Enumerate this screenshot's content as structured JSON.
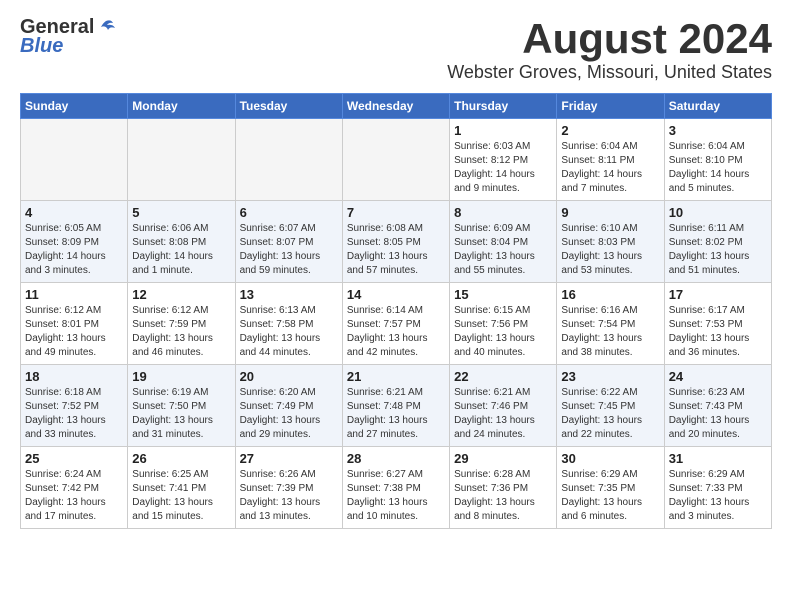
{
  "header": {
    "logo_general": "General",
    "logo_blue": "Blue",
    "month": "August 2024",
    "location": "Webster Groves, Missouri, United States"
  },
  "weekdays": [
    "Sunday",
    "Monday",
    "Tuesday",
    "Wednesday",
    "Thursday",
    "Friday",
    "Saturday"
  ],
  "weeks": [
    [
      {
        "day": "",
        "info": ""
      },
      {
        "day": "",
        "info": ""
      },
      {
        "day": "",
        "info": ""
      },
      {
        "day": "",
        "info": ""
      },
      {
        "day": "1",
        "info": "Sunrise: 6:03 AM\nSunset: 8:12 PM\nDaylight: 14 hours\nand 9 minutes."
      },
      {
        "day": "2",
        "info": "Sunrise: 6:04 AM\nSunset: 8:11 PM\nDaylight: 14 hours\nand 7 minutes."
      },
      {
        "day": "3",
        "info": "Sunrise: 6:04 AM\nSunset: 8:10 PM\nDaylight: 14 hours\nand 5 minutes."
      }
    ],
    [
      {
        "day": "4",
        "info": "Sunrise: 6:05 AM\nSunset: 8:09 PM\nDaylight: 14 hours\nand 3 minutes."
      },
      {
        "day": "5",
        "info": "Sunrise: 6:06 AM\nSunset: 8:08 PM\nDaylight: 14 hours\nand 1 minute."
      },
      {
        "day": "6",
        "info": "Sunrise: 6:07 AM\nSunset: 8:07 PM\nDaylight: 13 hours\nand 59 minutes."
      },
      {
        "day": "7",
        "info": "Sunrise: 6:08 AM\nSunset: 8:05 PM\nDaylight: 13 hours\nand 57 minutes."
      },
      {
        "day": "8",
        "info": "Sunrise: 6:09 AM\nSunset: 8:04 PM\nDaylight: 13 hours\nand 55 minutes."
      },
      {
        "day": "9",
        "info": "Sunrise: 6:10 AM\nSunset: 8:03 PM\nDaylight: 13 hours\nand 53 minutes."
      },
      {
        "day": "10",
        "info": "Sunrise: 6:11 AM\nSunset: 8:02 PM\nDaylight: 13 hours\nand 51 minutes."
      }
    ],
    [
      {
        "day": "11",
        "info": "Sunrise: 6:12 AM\nSunset: 8:01 PM\nDaylight: 13 hours\nand 49 minutes."
      },
      {
        "day": "12",
        "info": "Sunrise: 6:12 AM\nSunset: 7:59 PM\nDaylight: 13 hours\nand 46 minutes."
      },
      {
        "day": "13",
        "info": "Sunrise: 6:13 AM\nSunset: 7:58 PM\nDaylight: 13 hours\nand 44 minutes."
      },
      {
        "day": "14",
        "info": "Sunrise: 6:14 AM\nSunset: 7:57 PM\nDaylight: 13 hours\nand 42 minutes."
      },
      {
        "day": "15",
        "info": "Sunrise: 6:15 AM\nSunset: 7:56 PM\nDaylight: 13 hours\nand 40 minutes."
      },
      {
        "day": "16",
        "info": "Sunrise: 6:16 AM\nSunset: 7:54 PM\nDaylight: 13 hours\nand 38 minutes."
      },
      {
        "day": "17",
        "info": "Sunrise: 6:17 AM\nSunset: 7:53 PM\nDaylight: 13 hours\nand 36 minutes."
      }
    ],
    [
      {
        "day": "18",
        "info": "Sunrise: 6:18 AM\nSunset: 7:52 PM\nDaylight: 13 hours\nand 33 minutes."
      },
      {
        "day": "19",
        "info": "Sunrise: 6:19 AM\nSunset: 7:50 PM\nDaylight: 13 hours\nand 31 minutes."
      },
      {
        "day": "20",
        "info": "Sunrise: 6:20 AM\nSunset: 7:49 PM\nDaylight: 13 hours\nand 29 minutes."
      },
      {
        "day": "21",
        "info": "Sunrise: 6:21 AM\nSunset: 7:48 PM\nDaylight: 13 hours\nand 27 minutes."
      },
      {
        "day": "22",
        "info": "Sunrise: 6:21 AM\nSunset: 7:46 PM\nDaylight: 13 hours\nand 24 minutes."
      },
      {
        "day": "23",
        "info": "Sunrise: 6:22 AM\nSunset: 7:45 PM\nDaylight: 13 hours\nand 22 minutes."
      },
      {
        "day": "24",
        "info": "Sunrise: 6:23 AM\nSunset: 7:43 PM\nDaylight: 13 hours\nand 20 minutes."
      }
    ],
    [
      {
        "day": "25",
        "info": "Sunrise: 6:24 AM\nSunset: 7:42 PM\nDaylight: 13 hours\nand 17 minutes."
      },
      {
        "day": "26",
        "info": "Sunrise: 6:25 AM\nSunset: 7:41 PM\nDaylight: 13 hours\nand 15 minutes."
      },
      {
        "day": "27",
        "info": "Sunrise: 6:26 AM\nSunset: 7:39 PM\nDaylight: 13 hours\nand 13 minutes."
      },
      {
        "day": "28",
        "info": "Sunrise: 6:27 AM\nSunset: 7:38 PM\nDaylight: 13 hours\nand 10 minutes."
      },
      {
        "day": "29",
        "info": "Sunrise: 6:28 AM\nSunset: 7:36 PM\nDaylight: 13 hours\nand 8 minutes."
      },
      {
        "day": "30",
        "info": "Sunrise: 6:29 AM\nSunset: 7:35 PM\nDaylight: 13 hours\nand 6 minutes."
      },
      {
        "day": "31",
        "info": "Sunrise: 6:29 AM\nSunset: 7:33 PM\nDaylight: 13 hours\nand 3 minutes."
      }
    ]
  ]
}
